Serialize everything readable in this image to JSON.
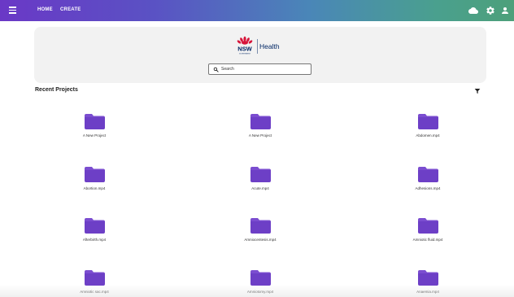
{
  "nav": {
    "home_label": "HOME",
    "create_label": "CREATE"
  },
  "toolbar_icons": [
    "cloud-icon",
    "gear-icon",
    "user-icon"
  ],
  "brand": {
    "name": "Health",
    "org": "NSW",
    "gov_line": "GOVERNMENT",
    "accent": "#d7153a",
    "navy": "#002664"
  },
  "search": {
    "placeholder": "Search"
  },
  "section": {
    "title": "Recent Projects"
  },
  "colors": {
    "folder": "#6d3fc6",
    "folder_tab": "#7b4dd0"
  },
  "projects": [
    {
      "label": "A New Project"
    },
    {
      "label": "A New Project"
    },
    {
      "label": "Abdomen.mp4"
    },
    {
      "label": "Abortion.mp4"
    },
    {
      "label": "Acute.mp4"
    },
    {
      "label": "Adhesions.mp4"
    },
    {
      "label": "Afterbirth.mp4"
    },
    {
      "label": "Amniocentesis.mp4"
    },
    {
      "label": "Amniotic fluid.mp4"
    },
    {
      "label": "Amniotic sac.mp4"
    },
    {
      "label": "Amniotomy.mp4"
    },
    {
      "label": "Anaemia.mp4"
    }
  ]
}
